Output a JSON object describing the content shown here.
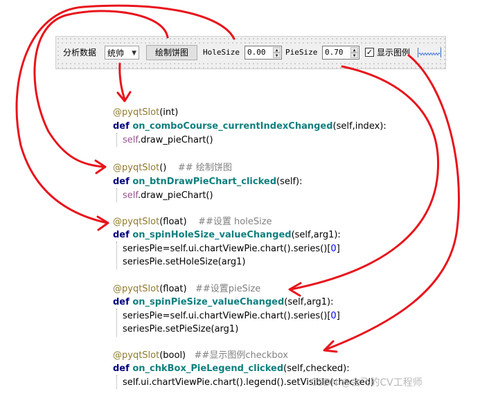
{
  "toolbar": {
    "analysis_label": "分析数据",
    "combo_value": "统帅",
    "draw_button": "绘制饼图",
    "holesize_label": "HoleSize",
    "holesize_value": "0.00",
    "piesize_label": "PieSize",
    "piesize_value": "0.70",
    "checkbox_label": "显示图例",
    "checkbox_checked": "✓"
  },
  "code": {
    "b1_deco": "@pyqtSlot",
    "b1_arg": "(int)",
    "b1_def": "def ",
    "b1_name": "on_comboCourse_currentIndexChanged",
    "b1_params_a": "(",
    "b1_self": "self",
    "b1_params_b": ",index):",
    "b1_body": ".draw_pieChart()",
    "b2_deco": "@pyqtSlot",
    "b2_arg": "()",
    "b2_comment": "    ## 绘制饼图",
    "b2_def": "def ",
    "b2_name": "on_btnDrawPieChart_clicked",
    "b2_params": "(self):",
    "b2_body": ".draw_pieChart()",
    "b3_deco": "@pyqtSlot",
    "b3_arg": "(float)",
    "b3_comment": "    ##设置 holeSize",
    "b3_def": "def ",
    "b3_name": "on_spinHoleSize_valueChanged",
    "b3_params": "(self,arg1):",
    "b3_l1": "seriesPie=self.ui.chartViewPie.chart().series()[",
    "b3_l1_num": "0",
    "b3_l1_end": "]",
    "b3_l2": "seriesPie.setHoleSize(arg1)",
    "b4_deco": "@pyqtSlot",
    "b4_arg": "(float)",
    "b4_comment": "   ##设置pieSize",
    "b4_def": "def ",
    "b4_name": "on_spinPieSize_valueChanged",
    "b4_params": "(self,arg1):",
    "b4_l1": "seriesPie=self.ui.chartViewPie.chart().series()[",
    "b4_l1_num": "0",
    "b4_l1_end": "]",
    "b4_l2": "seriesPie.setPieSize(arg1)",
    "b5_deco": "@pyqtSlot",
    "b5_arg": "(bool)",
    "b5_comment": "   ##显示图例checkbox",
    "b5_def": "def ",
    "b5_name": "on_chkBox_PieLegend_clicked",
    "b5_params": "(self,checked):",
    "b5_l1": "self.ui.chartViewPie.chart().legend().setVisible(checked)",
    "self_word": "self"
  },
  "watermark": "CSDN @会飞的CV工程师",
  "colors": {
    "arrow": "#e8131b",
    "decorator": "#8f7a2c",
    "keyword": "#000080",
    "function": "#0f7f7f"
  }
}
